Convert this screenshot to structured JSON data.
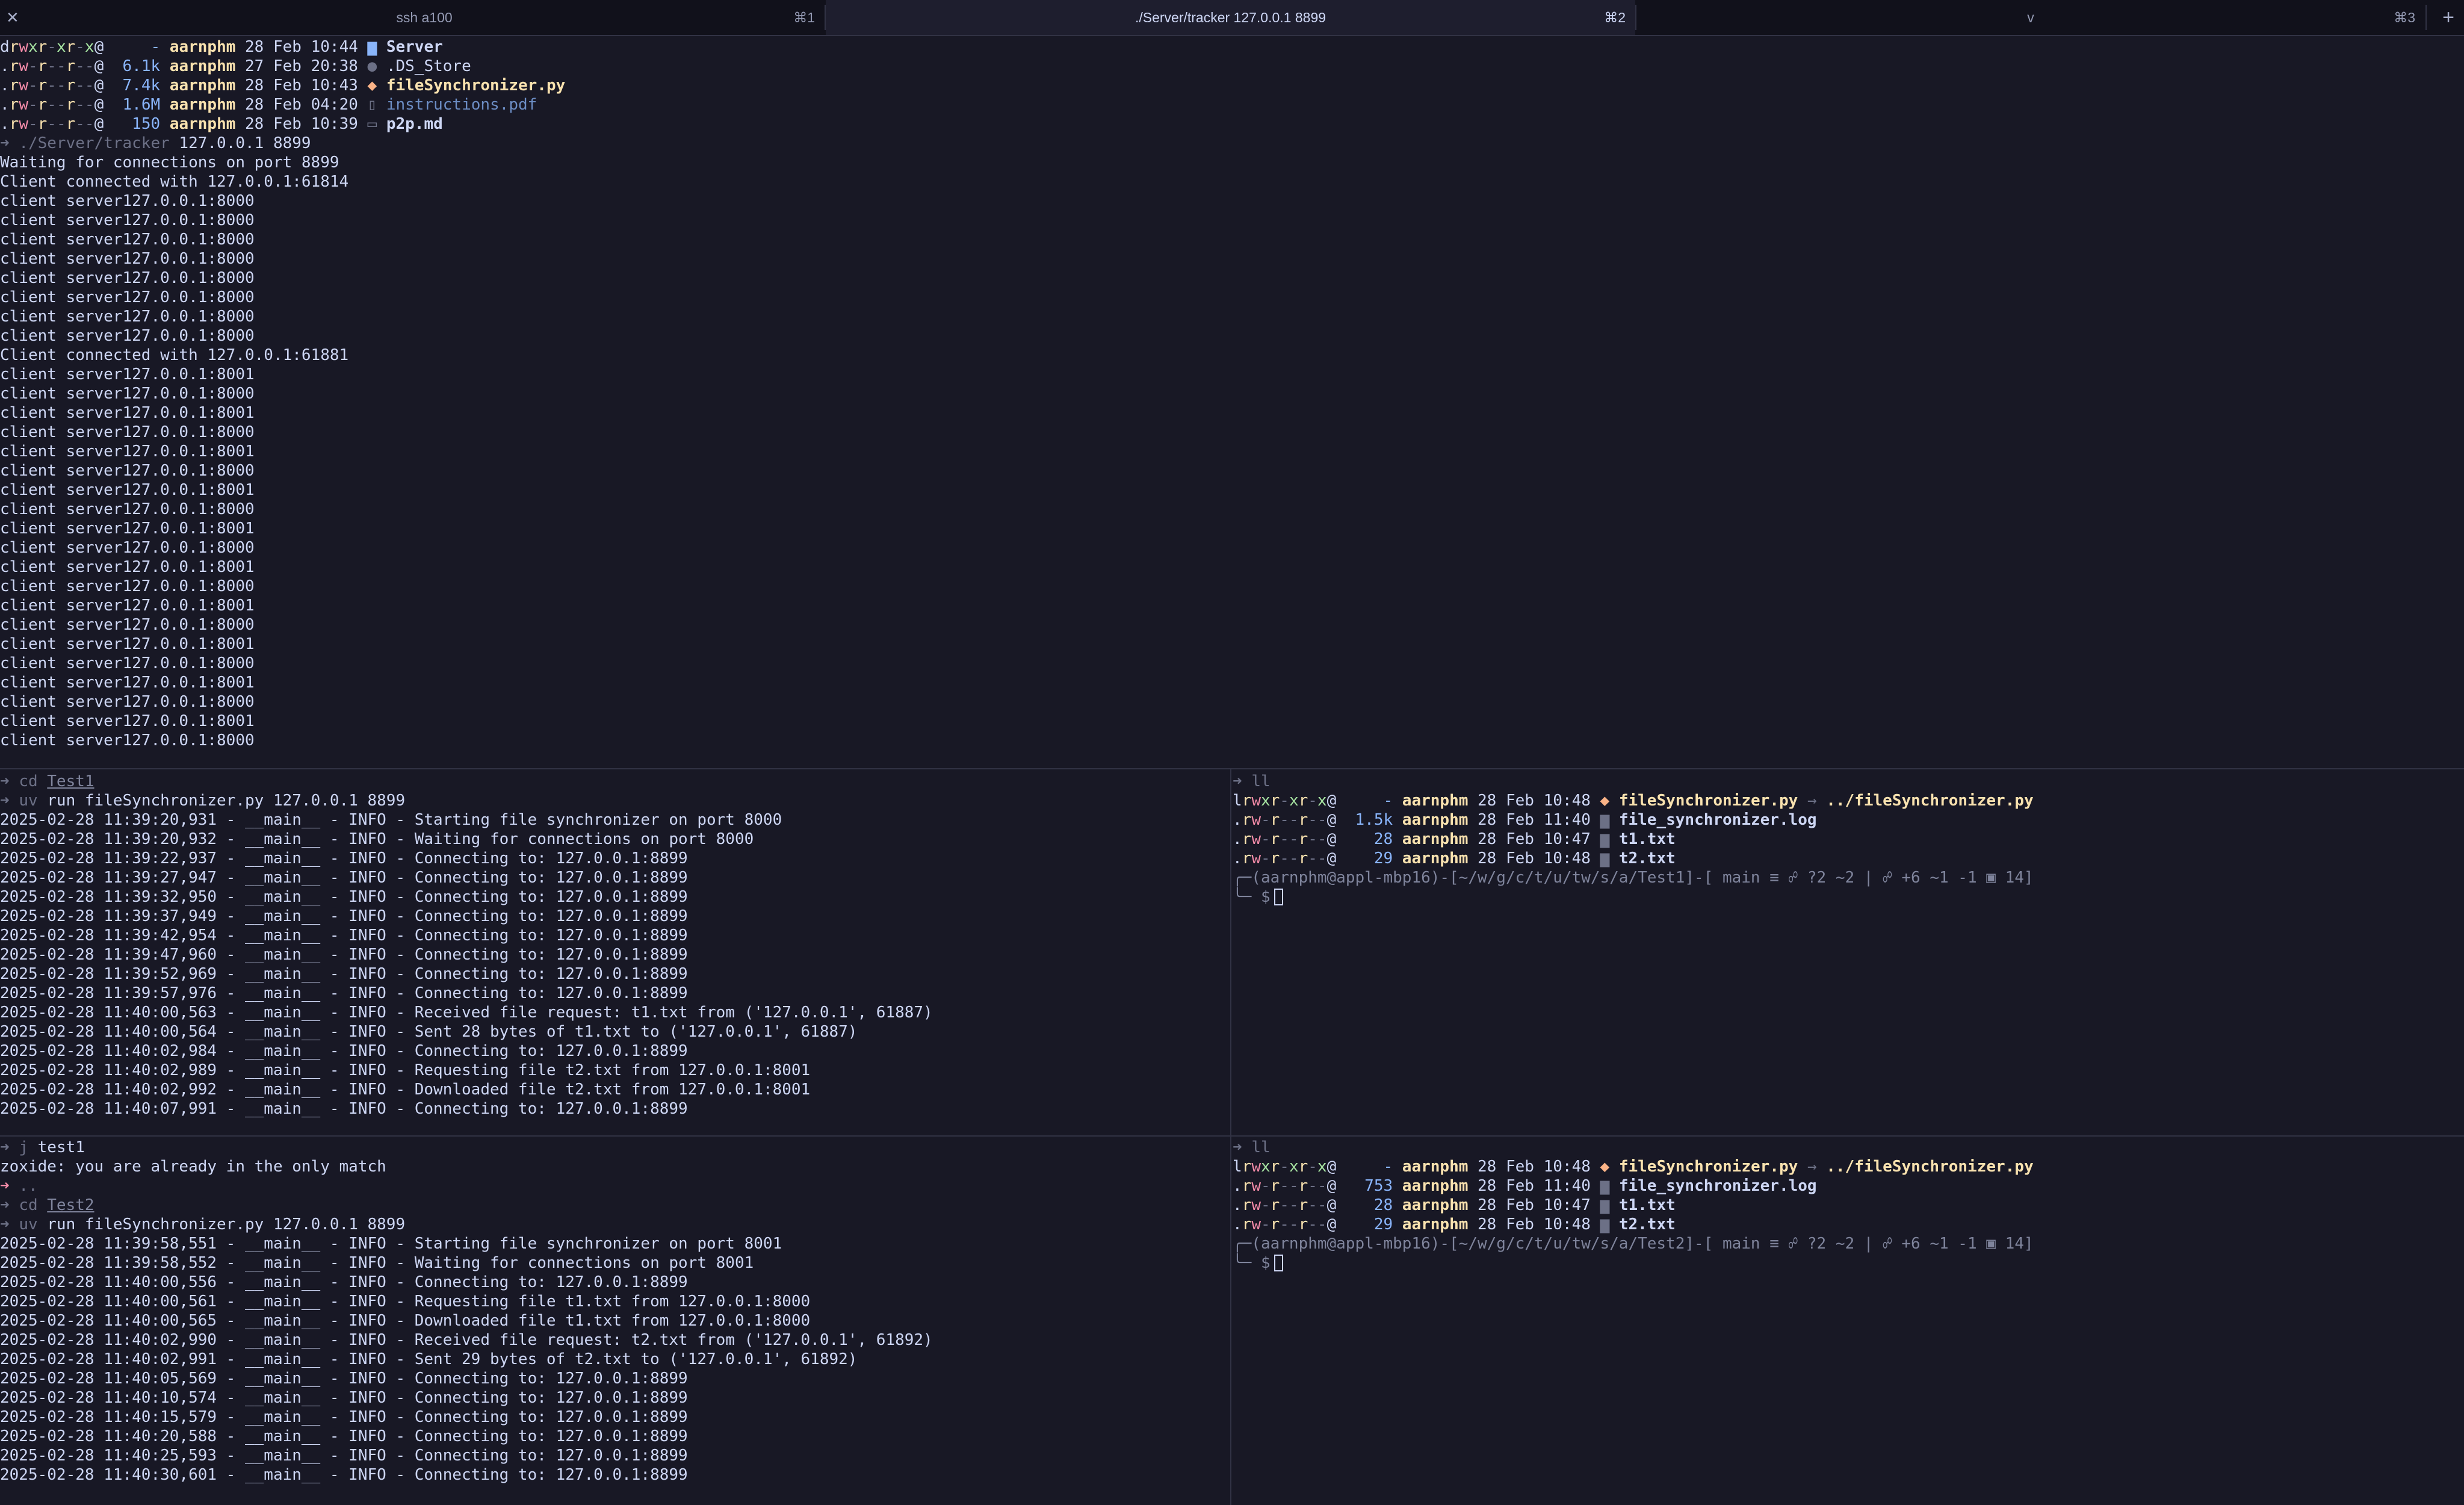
{
  "tabs": [
    {
      "title": "ssh a100",
      "shortcut": "⌘1"
    },
    {
      "title": "./Server/tracker 127.0.0.1 8899",
      "shortcut": "⌘2"
    },
    {
      "title": "v",
      "shortcut": "⌘3"
    }
  ],
  "tabbar": {
    "close": "✕",
    "new_tab": "+"
  },
  "pane_tracker": {
    "ls": [
      {
        "perm": "drwxr-xr-x@",
        "size": "-",
        "user": "aarnphm",
        "date": "28 Feb 10:44",
        "icon": "▆",
        "name": "Server"
      },
      {
        "perm": ".rw-r--r--@",
        "size": "6.1k",
        "user": "aarnphm",
        "date": "27 Feb 20:38",
        "icon": "●",
        "name": ".DS_Store"
      },
      {
        "perm": ".rw-r--r--@",
        "size": "7.4k",
        "user": "aarnphm",
        "date": "28 Feb 10:43",
        "icon": "◆",
        "name": "fileSynchronizer.py"
      },
      {
        "perm": ".rw-r--r--@",
        "size": "1.6M",
        "user": "aarnphm",
        "date": "28 Feb 04:20",
        "icon": "▯",
        "name": "instructions.pdf"
      },
      {
        "perm": ".rw-r--r--@",
        "size": "150",
        "user": "aarnphm",
        "date": "28 Feb 10:39",
        "icon": "▭",
        "name": "p2p.md"
      }
    ],
    "prompt_symbol": "➜",
    "command_path": "./Server/tracker",
    "command_args": "127.0.0.1 8899",
    "output": [
      "Waiting for connections on port 8899",
      "Client connected with 127.0.0.1:61814",
      "client server127.0.0.1:8000",
      "client server127.0.0.1:8000",
      "client server127.0.0.1:8000",
      "client server127.0.0.1:8000",
      "client server127.0.0.1:8000",
      "client server127.0.0.1:8000",
      "client server127.0.0.1:8000",
      "client server127.0.0.1:8000",
      "Client connected with 127.0.0.1:61881",
      "client server127.0.0.1:8001",
      "client server127.0.0.1:8000",
      "client server127.0.0.1:8001",
      "client server127.0.0.1:8000",
      "client server127.0.0.1:8001",
      "client server127.0.0.1:8000",
      "client server127.0.0.1:8001",
      "client server127.0.0.1:8000",
      "client server127.0.0.1:8001",
      "client server127.0.0.1:8000",
      "client server127.0.0.1:8001",
      "client server127.0.0.1:8000",
      "client server127.0.0.1:8001",
      "client server127.0.0.1:8000",
      "client server127.0.0.1:8001",
      "client server127.0.0.1:8000",
      "client server127.0.0.1:8001",
      "client server127.0.0.1:8000",
      "client server127.0.0.1:8001",
      "client server127.0.0.1:8000"
    ]
  },
  "pane_test1": {
    "cd_cmd": "cd",
    "cd_dir": "Test1",
    "run_cmd": "uv",
    "run_args": "run fileSynchronizer.py 127.0.0.1 8899",
    "logs": [
      "2025-02-28 11:39:20,931 - __main__ - INFO - Starting file synchronizer on port 8000",
      "2025-02-28 11:39:20,932 - __main__ - INFO - Waiting for connections on port 8000",
      "2025-02-28 11:39:22,937 - __main__ - INFO - Connecting to: 127.0.0.1:8899",
      "2025-02-28 11:39:27,947 - __main__ - INFO - Connecting to: 127.0.0.1:8899",
      "2025-02-28 11:39:32,950 - __main__ - INFO - Connecting to: 127.0.0.1:8899",
      "2025-02-28 11:39:37,949 - __main__ - INFO - Connecting to: 127.0.0.1:8899",
      "2025-02-28 11:39:42,954 - __main__ - INFO - Connecting to: 127.0.0.1:8899",
      "2025-02-28 11:39:47,960 - __main__ - INFO - Connecting to: 127.0.0.1:8899",
      "2025-02-28 11:39:52,969 - __main__ - INFO - Connecting to: 127.0.0.1:8899",
      "2025-02-28 11:39:57,976 - __main__ - INFO - Connecting to: 127.0.0.1:8899",
      "2025-02-28 11:40:00,563 - __main__ - INFO - Received file request: t1.txt from ('127.0.0.1', 61887)",
      "2025-02-28 11:40:00,564 - __main__ - INFO - Sent 28 bytes of t1.txt to ('127.0.0.1', 61887)",
      "2025-02-28 11:40:02,984 - __main__ - INFO - Connecting to: 127.0.0.1:8899",
      "2025-02-28 11:40:02,989 - __main__ - INFO - Requesting file t2.txt from 127.0.0.1:8001",
      "2025-02-28 11:40:02,992 - __main__ - INFO - Downloaded file t2.txt from 127.0.0.1:8001",
      "2025-02-28 11:40:07,991 - __main__ - INFO - Connecting to: 127.0.0.1:8899"
    ]
  },
  "pane_ls1": {
    "cmd": "ll",
    "rows": [
      {
        "perm": "lrwxr-xr-x@",
        "size": "-",
        "user": "aarnphm",
        "date": "28 Feb 10:48",
        "icon": "◆",
        "name": "fileSynchronizer.py",
        "link_arrow": "→",
        "link_target": "../fileSynchronizer.py"
      },
      {
        "perm": ".rw-r--r--@",
        "size": "1.5k",
        "user": "aarnphm",
        "date": "28 Feb 11:40",
        "icon": "▆",
        "name": "file_synchronizer.log"
      },
      {
        "perm": ".rw-r--r--@",
        "size": "28",
        "user": "aarnphm",
        "date": "28 Feb 10:47",
        "icon": "▆",
        "name": "t1.txt"
      },
      {
        "perm": ".rw-r--r--@",
        "size": "29",
        "user": "aarnphm",
        "date": "28 Feb 10:48",
        "icon": "▆",
        "name": "t2.txt"
      }
    ],
    "prompt_top": "╭─(aarnphm@appl-mbp16)-[~/w/g/c/t/u/tw/s/a/Test1]-[ main ≡ ☍ ?2 ~2 | ☍ +6 ~1 -1 ▣ 14]",
    "prompt_bottom": "╰─ $"
  },
  "pane_test2": {
    "j_cmd": "j",
    "j_arg": "test1",
    "zoxide_msg": "zoxide: you are already in the only match",
    "dotdot": "..",
    "cd_cmd": "cd",
    "cd_dir": "Test2",
    "run_cmd": "uv",
    "run_args": "run fileSynchronizer.py 127.0.0.1 8899",
    "logs": [
      "2025-02-28 11:39:58,551 - __main__ - INFO - Starting file synchronizer on port 8001",
      "2025-02-28 11:39:58,552 - __main__ - INFO - Waiting for connections on port 8001",
      "2025-02-28 11:40:00,556 - __main__ - INFO - Connecting to: 127.0.0.1:8899",
      "2025-02-28 11:40:00,561 - __main__ - INFO - Requesting file t1.txt from 127.0.0.1:8000",
      "2025-02-28 11:40:00,565 - __main__ - INFO - Downloaded file t1.txt from 127.0.0.1:8000",
      "2025-02-28 11:40:02,990 - __main__ - INFO - Received file request: t2.txt from ('127.0.0.1', 61892)",
      "2025-02-28 11:40:02,991 - __main__ - INFO - Sent 29 bytes of t2.txt to ('127.0.0.1', 61892)",
      "2025-02-28 11:40:05,569 - __main__ - INFO - Connecting to: 127.0.0.1:8899",
      "2025-02-28 11:40:10,574 - __main__ - INFO - Connecting to: 127.0.0.1:8899",
      "2025-02-28 11:40:15,579 - __main__ - INFO - Connecting to: 127.0.0.1:8899",
      "2025-02-28 11:40:20,588 - __main__ - INFO - Connecting to: 127.0.0.1:8899",
      "2025-02-28 11:40:25,593 - __main__ - INFO - Connecting to: 127.0.0.1:8899",
      "2025-02-28 11:40:30,601 - __main__ - INFO - Connecting to: 127.0.0.1:8899"
    ]
  },
  "pane_ls2": {
    "cmd": "ll",
    "rows": [
      {
        "perm": "lrwxr-xr-x@",
        "size": "-",
        "user": "aarnphm",
        "date": "28 Feb 10:48",
        "icon": "◆",
        "name": "fileSynchronizer.py",
        "link_arrow": "→",
        "link_target": "../fileSynchronizer.py"
      },
      {
        "perm": ".rw-r--r--@",
        "size": "753",
        "user": "aarnphm",
        "date": "28 Feb 11:40",
        "icon": "▆",
        "name": "file_synchronizer.log"
      },
      {
        "perm": ".rw-r--r--@",
        "size": "28",
        "user": "aarnphm",
        "date": "28 Feb 10:47",
        "icon": "▆",
        "name": "t1.txt"
      },
      {
        "perm": ".rw-r--r--@",
        "size": "29",
        "user": "aarnphm",
        "date": "28 Feb 10:48",
        "icon": "▆",
        "name": "t2.txt"
      }
    ],
    "prompt_top": "╭─(aarnphm@appl-mbp16)-[~/w/g/c/t/u/tw/s/a/Test2]-[ main ≡ ☍ ?2 ~2 | ☍ +6 ~1 -1 ▣ 14]",
    "prompt_bottom": "╰─ $"
  },
  "colors": {
    "background": "#181825",
    "tabbar": "#11111b",
    "foreground": "#cdd6f4",
    "user": "#f9e2af",
    "size": "#89b4fa",
    "perm_write": "#f38ba8",
    "perm_exec": "#a6e3a1"
  }
}
